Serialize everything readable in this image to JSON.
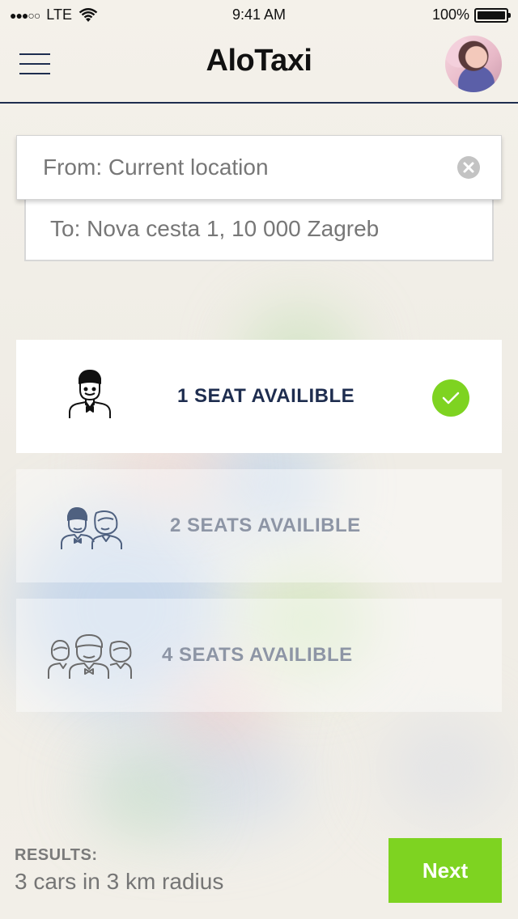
{
  "status_bar": {
    "carrier_signal": "●●●○○",
    "network": "LTE",
    "time": "9:41 AM",
    "battery_percent": "100%",
    "battery_level": 1.0
  },
  "header": {
    "title": "AloTaxi",
    "menu_icon": "hamburger-menu-icon",
    "avatar": "user-avatar"
  },
  "route": {
    "from_value": "From: Current location",
    "to_value": "To: Nova cesta 1, 10 000 Zagreb",
    "clear_icon": "clear-icon"
  },
  "seat_options": [
    {
      "label": "1 SEAT AVAILIBLE",
      "icon": "one-person-icon",
      "selected": true
    },
    {
      "label": "2 SEATS AVAILIBLE",
      "icon": "two-people-icon",
      "selected": false
    },
    {
      "label": "4 SEATS AVAILIBLE",
      "icon": "three-people-icon",
      "selected": false
    }
  ],
  "results": {
    "title": "RESULTS:",
    "value": "3 cars in 3 km radius"
  },
  "next_button": {
    "label": "Next"
  },
  "colors": {
    "navy": "#1e2d4f",
    "accent_green": "#7ed321",
    "muted_text": "#8d95a5"
  }
}
